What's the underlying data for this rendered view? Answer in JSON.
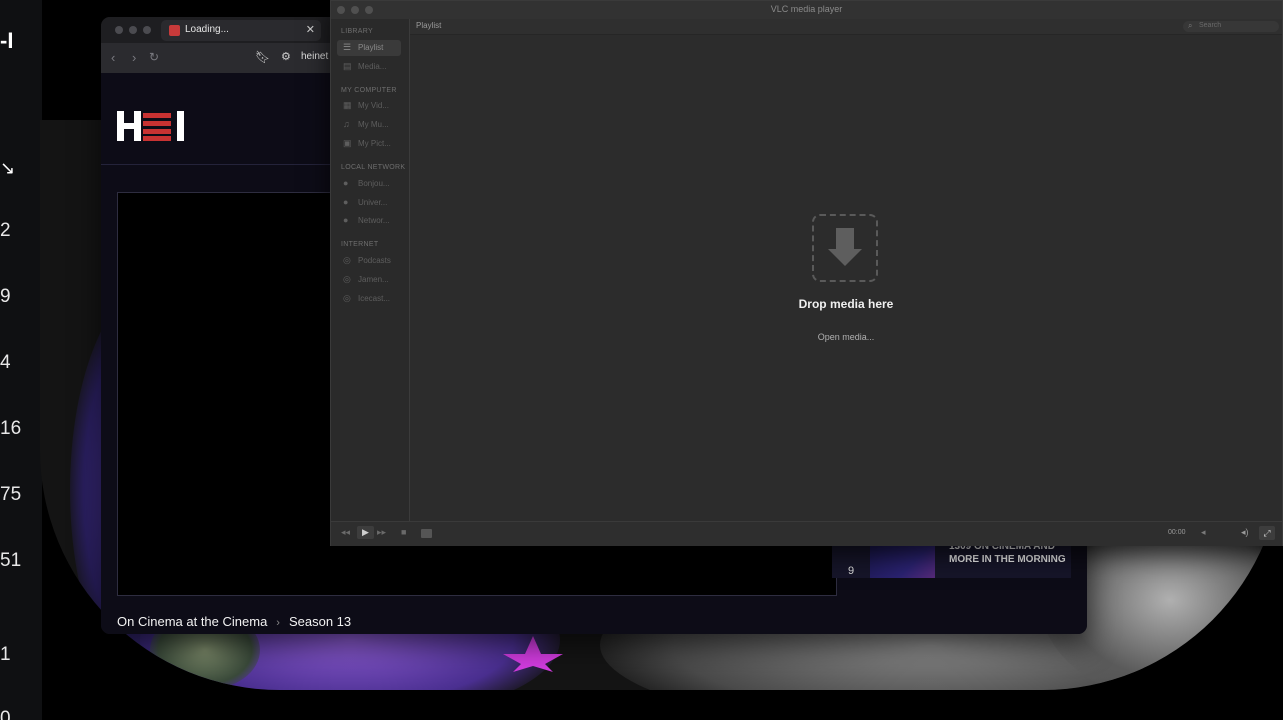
{
  "left_strip": {
    "numbers": [
      "2",
      "9",
      "4",
      "16",
      "75",
      "51",
      "1",
      "0"
    ]
  },
  "browser": {
    "tab_title": "Loading...",
    "url_text": "heinet",
    "episode_card": {
      "number": "9",
      "title": "1309 ON CINEMA AND MORE IN THE MORNING"
    },
    "breadcrumb": {
      "show": "On Cinema at the Cinema",
      "separator": "›",
      "season": "Season 13"
    }
  },
  "vlc": {
    "window_title": "VLC media player",
    "sections": {
      "library": "LIBRARY",
      "my_computer": "MY COMPUTER",
      "local_network": "LOCAL NETWORK",
      "internet": "INTERNET"
    },
    "items": {
      "playlist": "Playlist",
      "media": "Media...",
      "videos": "My Vid...",
      "music": "My Mu...",
      "pictures": "My Pict...",
      "bonjour": "Bonjou...",
      "upnp": "Univer...",
      "network": "Networ...",
      "podcasts": "Podcasts",
      "jamendo": "Jamen...",
      "icecast": "Icecast..."
    },
    "main_header": "Playlist",
    "search_placeholder": "Search",
    "drop_text": "Drop media here",
    "open_media": "Open media...",
    "time": "00:00"
  }
}
